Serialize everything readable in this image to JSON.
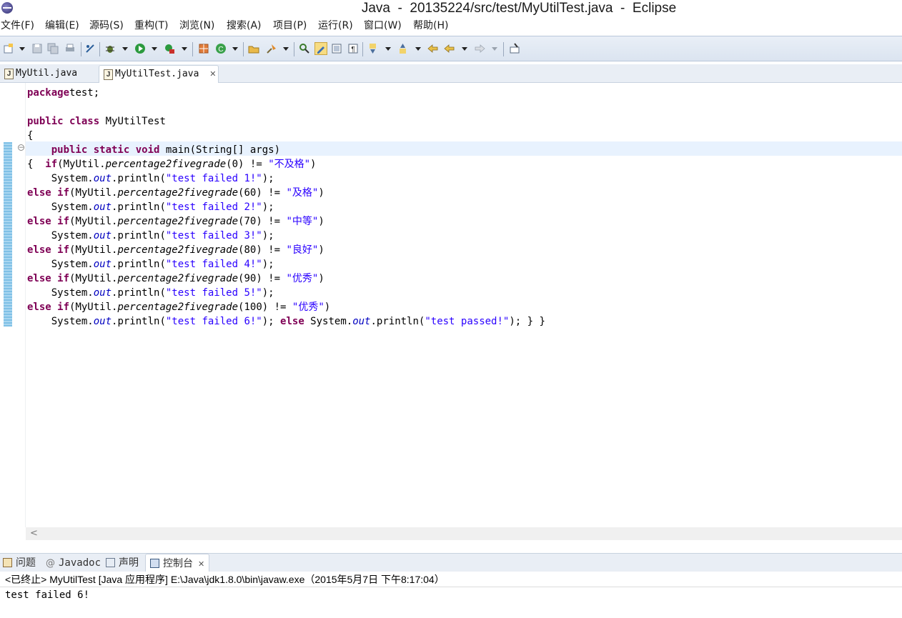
{
  "window": {
    "title": "Java  -  20135224/src/test/MyUtilTest.java  -  Eclipse"
  },
  "menu": [
    "文件(F)",
    "编辑(E)",
    "源码(S)",
    "重构(T)",
    "浏览(N)",
    "搜索(A)",
    "项目(P)",
    "运行(R)",
    "窗口(W)",
    "帮助(H)"
  ],
  "toolbar": {
    "icons": [
      "new-icon",
      "save-icon",
      "save-all-icon",
      "print-icon",
      "toggle-breakpoint-icon",
      "debug-icon",
      "run-icon",
      "external-tools-icon",
      "new-java-project-icon",
      "new-class-icon",
      "open-type-icon",
      "search-icon",
      "toggle-mark-occurrences-icon",
      "highlight-icon",
      "show-whitespace-icon",
      "block-selection-icon",
      "next-annotation-icon",
      "previous-annotation-icon",
      "last-edit-icon",
      "back-icon",
      "forward-icon",
      "pin-editor-icon"
    ]
  },
  "editor_tabs": [
    {
      "label": "MyUtil.java",
      "active": false
    },
    {
      "label": "MyUtilTest.java",
      "active": true
    }
  ],
  "code": {
    "lines": [
      [
        [
          "kw",
          "package"
        ],
        [
          "",
          "test;"
        ]
      ],
      [],
      [
        [
          "kw",
          "public"
        ],
        [
          "",
          ""
        ],
        [
          "kw",
          " class"
        ],
        [
          "",
          " MyUtilTest"
        ]
      ],
      [
        [
          "",
          "{"
        ]
      ],
      [
        [
          "",
          "    "
        ],
        [
          "kw",
          "public static void"
        ],
        [
          "",
          " main(String[] args)"
        ]
      ],
      [
        [
          "",
          "{  "
        ],
        [
          "kw",
          "if"
        ],
        [
          "",
          "(MyUtil."
        ],
        [
          "sm",
          "percentage2fivegrade"
        ],
        [
          "",
          "(0) != "
        ],
        [
          "str",
          "\"不及格\""
        ],
        [
          "",
          ")"
        ]
      ],
      [
        [
          "",
          "    System."
        ],
        [
          "fld",
          "out"
        ],
        [
          "",
          ".println("
        ],
        [
          "str",
          "\"test failed 1!\""
        ],
        [
          "",
          ");"
        ]
      ],
      [
        [
          "kw",
          "else if"
        ],
        [
          "",
          "(MyUtil."
        ],
        [
          "sm",
          "percentage2fivegrade"
        ],
        [
          "",
          "(60) != "
        ],
        [
          "str",
          "\"及格\""
        ],
        [
          "",
          ")"
        ]
      ],
      [
        [
          "",
          "    System."
        ],
        [
          "fld",
          "out"
        ],
        [
          "",
          ".println("
        ],
        [
          "str",
          "\"test failed 2!\""
        ],
        [
          "",
          ");"
        ]
      ],
      [
        [
          "kw",
          "else if"
        ],
        [
          "",
          "(MyUtil."
        ],
        [
          "sm",
          "percentage2fivegrade"
        ],
        [
          "",
          "(70) != "
        ],
        [
          "str",
          "\"中等\""
        ],
        [
          "",
          ")"
        ]
      ],
      [
        [
          "",
          "    System."
        ],
        [
          "fld",
          "out"
        ],
        [
          "",
          ".println("
        ],
        [
          "str",
          "\"test failed 3!\""
        ],
        [
          "",
          ");"
        ]
      ],
      [
        [
          "kw",
          "else if"
        ],
        [
          "",
          "(MyUtil."
        ],
        [
          "sm",
          "percentage2fivegrade"
        ],
        [
          "",
          "(80) != "
        ],
        [
          "str",
          "\"良好\""
        ],
        [
          "",
          ")"
        ]
      ],
      [
        [
          "",
          "    System."
        ],
        [
          "fld",
          "out"
        ],
        [
          "",
          ".println("
        ],
        [
          "str",
          "\"test failed 4!\""
        ],
        [
          "",
          ");"
        ]
      ],
      [
        [
          "kw",
          "else if"
        ],
        [
          "",
          "(MyUtil."
        ],
        [
          "sm",
          "percentage2fivegrade"
        ],
        [
          "",
          "(90) != "
        ],
        [
          "str",
          "\"优秀\""
        ],
        [
          "",
          ")"
        ]
      ],
      [
        [
          "",
          "    System."
        ],
        [
          "fld",
          "out"
        ],
        [
          "",
          ".println("
        ],
        [
          "str",
          "\"test failed 5!\""
        ],
        [
          "",
          ");"
        ]
      ],
      [
        [
          "kw",
          "else if"
        ],
        [
          "",
          "(MyUtil."
        ],
        [
          "sm",
          "percentage2fivegrade"
        ],
        [
          "",
          "(100) != "
        ],
        [
          "str",
          "\"优秀\""
        ],
        [
          "",
          ")"
        ]
      ],
      [
        [
          "",
          "    System."
        ],
        [
          "fld",
          "out"
        ],
        [
          "",
          ".println("
        ],
        [
          "str",
          "\"test failed 6!\""
        ],
        [
          "",
          "); "
        ],
        [
          "kw",
          "else"
        ],
        [
          "",
          " System."
        ],
        [
          "fld",
          "out"
        ],
        [
          "",
          ".println("
        ],
        [
          "str",
          "\"test passed!\""
        ],
        [
          "",
          "); } }"
        ]
      ]
    ]
  },
  "bottom_tabs": [
    {
      "label": "问题",
      "icon": "problems-icon",
      "active": false
    },
    {
      "label": "Javadoc",
      "icon": "at-icon",
      "active": false
    },
    {
      "label": "声明",
      "icon": "declaration-icon",
      "active": false
    },
    {
      "label": "控制台",
      "icon": "console-icon",
      "active": true
    }
  ],
  "console": {
    "header": "<已终止> MyUtilTest [Java 应用程序] E:\\Java\\jdk1.8.0\\bin\\javaw.exe（2015年5月7日 下午8:17:04）",
    "output": "test failed 6!"
  }
}
